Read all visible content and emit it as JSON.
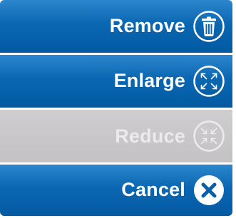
{
  "menu": {
    "items": [
      {
        "label": "Remove",
        "icon": "trash-icon",
        "enabled": true
      },
      {
        "label": "Enlarge",
        "icon": "expand-arrows-icon",
        "enabled": true
      },
      {
        "label": "Reduce",
        "icon": "shrink-arrows-icon",
        "enabled": false
      },
      {
        "label": "Cancel",
        "icon": "close-icon",
        "enabled": true
      }
    ]
  },
  "colors": {
    "enabled_background": "#0b67b2",
    "disabled_background": "#c9c7c9",
    "label_text": "#ffffff"
  }
}
